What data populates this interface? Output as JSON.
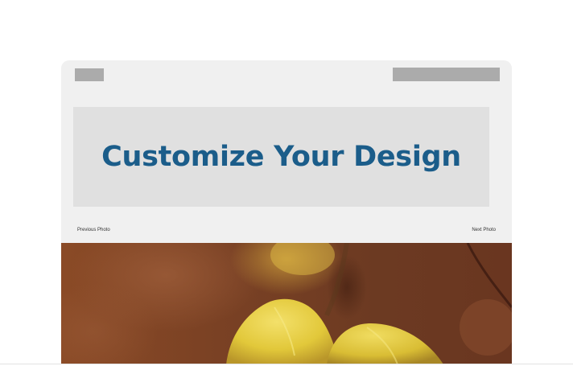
{
  "banner": {
    "title": "Customize Your Design"
  },
  "gallery": {
    "previous_label": "Previous Photo",
    "next_label": "Next Photo",
    "photo_subject": "yellow flower petals against a brown blurred background"
  },
  "colors": {
    "title_blue": "#1b5d8a",
    "card_background": "#f0f0f0",
    "banner_background": "#e0e0e0",
    "placeholder_gray": "#ababab",
    "photo_brown": "#7a3f22",
    "petal_yellow": "#e6cf3c"
  }
}
